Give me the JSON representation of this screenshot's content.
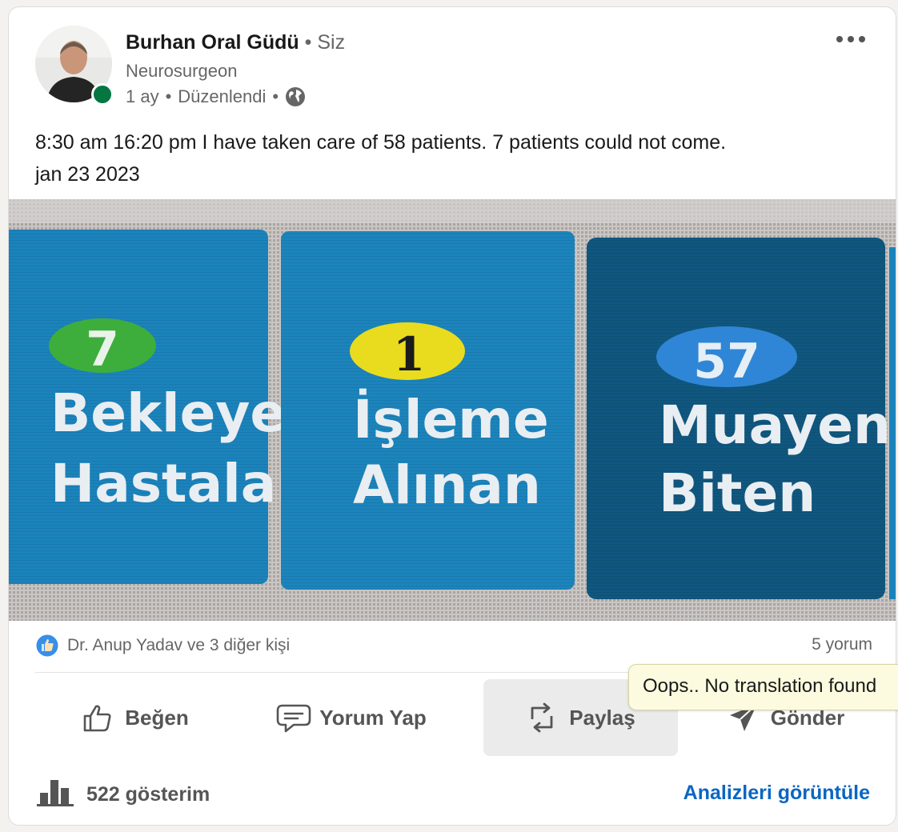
{
  "post": {
    "author": {
      "name": "Burhan Oral Güdü",
      "separator": "•",
      "relation": "Siz",
      "headline": "Neurosurgeon",
      "time": "1 ay",
      "edited": "Düzenlendi",
      "visibility_icon": "globe-icon"
    },
    "text_line1": "8:30 am 16:20 pm I have taken care of 58 patients. 7 patients could not come.",
    "text_line2": "jan 23 2023",
    "image": {
      "tiles": [
        {
          "count": "7",
          "line1": "Bekleyeı",
          "line2": "Hastalaı",
          "badge_color": "#3dae3c"
        },
        {
          "count": "1",
          "line1": "İşleme",
          "line2": "Alınan",
          "badge_color": "#e9dc1e"
        },
        {
          "count": "57",
          "line1": "Muayen",
          "line2": "Biten",
          "badge_color": "#2f86d6"
        }
      ]
    },
    "reactions_text": "Dr. Anup Yadav ve 3 diğer kişi",
    "comments_text": "5 yorum",
    "actions": {
      "like": "Beğen",
      "comment": "Yorum Yap",
      "repost": "Paylaş",
      "send": "Gönder"
    },
    "impressions": "522 gösterim",
    "analytics_link": "Analizleri görüntüle"
  },
  "tooltip": "Oops.. No translation found",
  "colors": {
    "link_blue": "#0a66c2",
    "presence_green": "#057642",
    "tile_blue": "#1c84bd",
    "tile_dark": "#10577f"
  }
}
